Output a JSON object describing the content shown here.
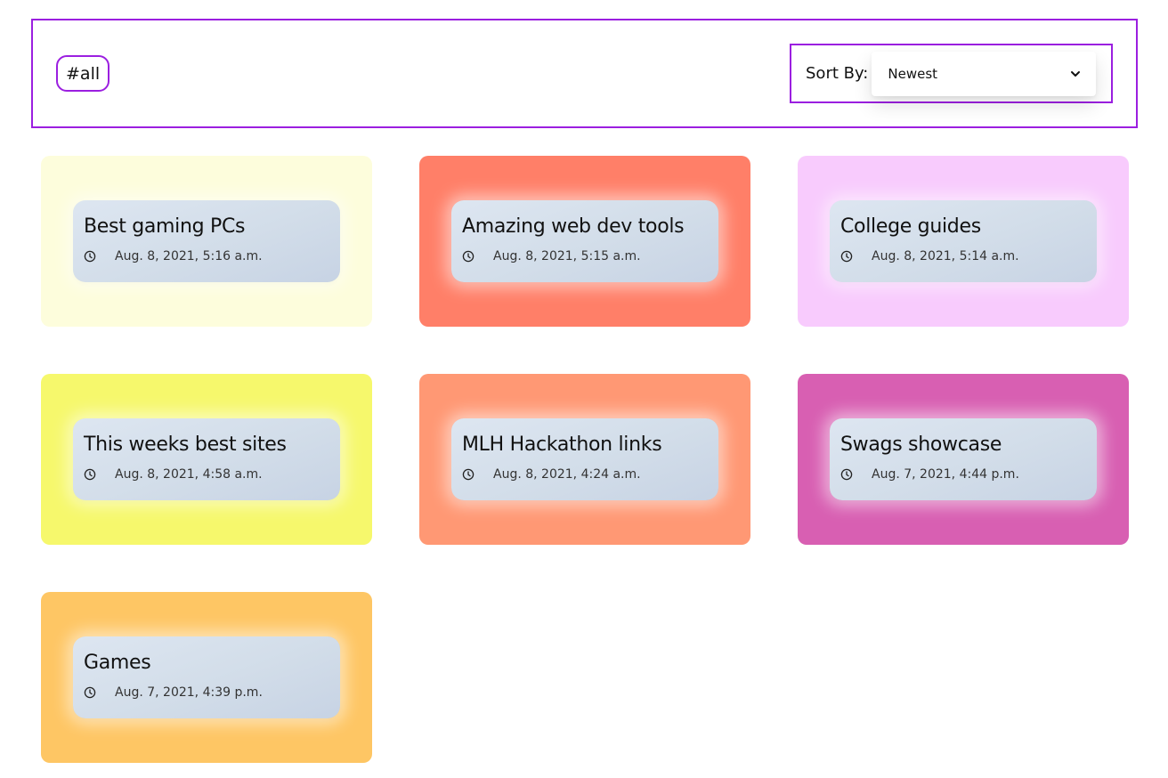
{
  "filter": {
    "tag": "#all"
  },
  "sort": {
    "label": "Sort By:",
    "selected": "Newest"
  },
  "icons": {
    "dropdown": "chevron-down-icon",
    "time": "clock-icon"
  },
  "accent_color": "#9b1fe0",
  "cards": [
    {
      "title": "Best gaming PCs",
      "date": "Aug. 8, 2021, 5:16 a.m.",
      "color": "#fdfddc"
    },
    {
      "title": "Amazing web dev tools",
      "date": "Aug. 8, 2021, 5:15 a.m.",
      "color": "#ff7f68"
    },
    {
      "title": "College guides",
      "date": "Aug. 8, 2021, 5:14 a.m.",
      "color": "#f8cbfd"
    },
    {
      "title": "This weeks best sites",
      "date": "Aug. 8, 2021, 4:58 a.m.",
      "color": "#f6f86c"
    },
    {
      "title": "MLH Hackathon links",
      "date": "Aug. 8, 2021, 4:24 a.m.",
      "color": "#ff9874"
    },
    {
      "title": "Swags showcase",
      "date": "Aug. 7, 2021, 4:44 p.m.",
      "color": "#d85fb2"
    },
    {
      "title": "Games",
      "date": "Aug. 7, 2021, 4:39 p.m.",
      "color": "#fec664"
    }
  ]
}
